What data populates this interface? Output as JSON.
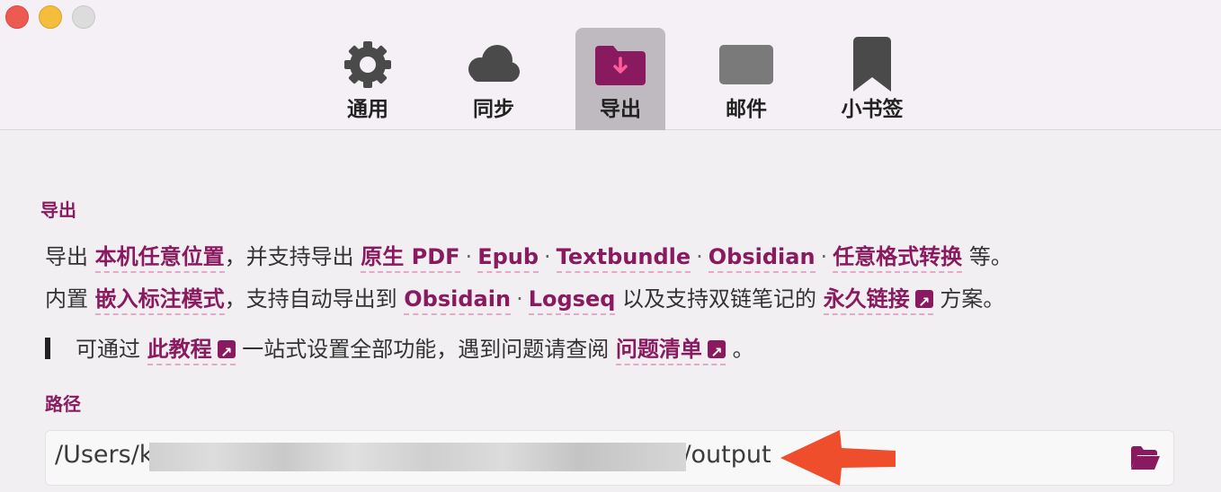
{
  "window": {
    "traffic_lights": [
      "close",
      "minimize",
      "zoom"
    ]
  },
  "toolbar": {
    "tabs": [
      {
        "label": "通用",
        "icon": "gear-icon",
        "active": false
      },
      {
        "label": "同步",
        "icon": "cloud-icon",
        "active": false
      },
      {
        "label": "导出",
        "icon": "folder-download-icon",
        "active": true
      },
      {
        "label": "邮件",
        "icon": "mail-icon",
        "active": false
      },
      {
        "label": "小书签",
        "icon": "bookmark-icon",
        "active": false
      }
    ]
  },
  "export": {
    "title": "导出",
    "line1": {
      "prefix": "导出",
      "link1": "本机任意位置",
      "mid": "，并支持导出",
      "formats": [
        "原生 PDF",
        "Epub",
        "Textbundle",
        "Obsidian",
        "任意格式转换"
      ],
      "separator": "·",
      "suffix": "等。"
    },
    "line2": {
      "prefix": "内置",
      "link1": "嵌入标注模式",
      "mid": "，支持自动导出到",
      "apps": [
        "Obsidain",
        "Logseq"
      ],
      "separator": "·",
      "mid2": "以及支持双链笔记的",
      "link2": "永久链接",
      "suffix": "方案。"
    },
    "note": {
      "prefix": "可通过",
      "link1": "此教程",
      "mid": "一站式设置全部功能，遇到问题请查阅",
      "link2": "问题清单",
      "suffix": "。"
    }
  },
  "path": {
    "title": "路径",
    "value_start": "/Users/k",
    "value_end": "/output",
    "redacted": true
  },
  "colors": {
    "accent": "#8a1a5f",
    "link_underline": "#e3a9c6",
    "annotation_arrow": "#ee4e2c"
  }
}
